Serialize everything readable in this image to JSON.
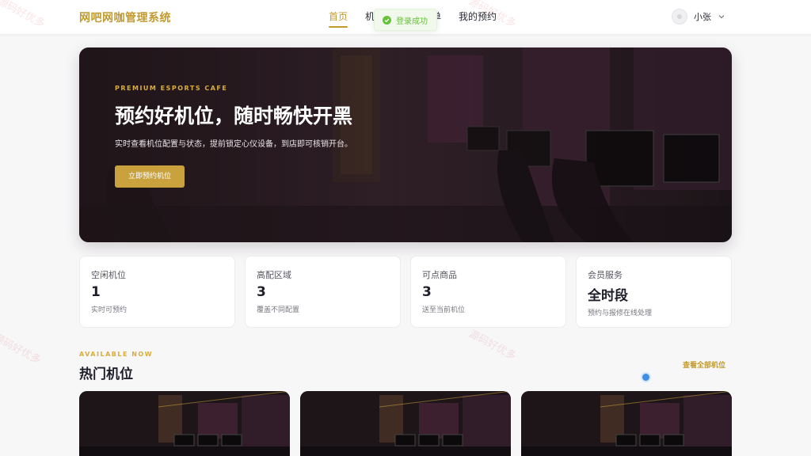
{
  "header": {
    "brand": "网吧网咖管理系统",
    "nav": [
      "首页",
      "机",
      "点单",
      "我的预约"
    ],
    "user_name": "小张"
  },
  "toast": {
    "text": "登录成功",
    "color": "#67c23a"
  },
  "hero": {
    "kicker": "PREMIUM ESPORTS CAFE",
    "title": "预约好机位，随时畅快开黑",
    "description": "实时查看机位配置与状态，提前锁定心仪设备，到店即可核销开台。",
    "button": "立即预约机位"
  },
  "stats": [
    {
      "label": "空闲机位",
      "value": "1",
      "note": "实时可预约"
    },
    {
      "label": "高配区域",
      "value": "3",
      "note": "覆盖不同配置"
    },
    {
      "label": "可点商品",
      "value": "3",
      "note": "送至当前机位"
    },
    {
      "label": "会员服务",
      "value": "全时段",
      "note": "预约与报修在线处理"
    }
  ],
  "section": {
    "kicker": "AVAILABLE NOW",
    "title": "热门机位",
    "link": "查看全部机位"
  },
  "watermark": "源码好优多",
  "colors": {
    "accent": "#c19a2f",
    "button": "#c9a23d",
    "background": "#f7f7f8"
  }
}
